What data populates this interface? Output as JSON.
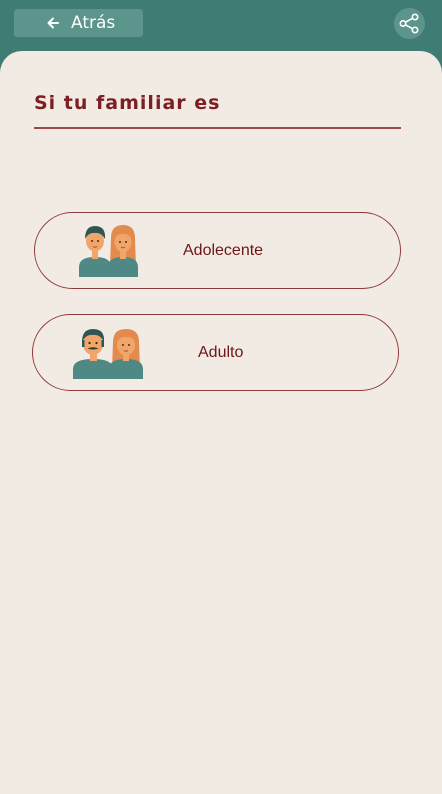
{
  "header": {
    "back_label": "Atrás",
    "back_icon": "arrow-left-icon",
    "share_icon": "share-icon"
  },
  "page": {
    "title": "Si tu familiar es"
  },
  "options": [
    {
      "label": "Adolecente",
      "icon": "teen-couple-icon"
    },
    {
      "label": "Adulto",
      "icon": "adult-couple-icon"
    }
  ],
  "colors": {
    "header_bg": "#3f7c73",
    "button_bg": "#5c958b",
    "sheet_bg": "#f1ebe3",
    "accent": "#7c1f22",
    "figure_teal": "#4f8884",
    "figure_orange": "#e38b4d",
    "hair_dark": "#2f5655"
  }
}
